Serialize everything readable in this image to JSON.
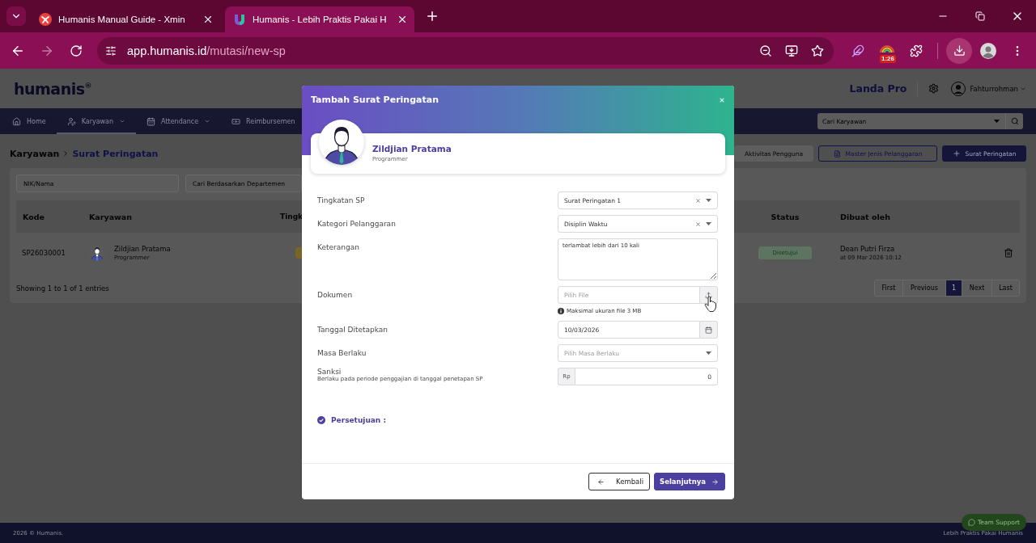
{
  "browser": {
    "tabs": [
      {
        "title": "Humanis Manual Guide - Xmin",
        "selected": false
      },
      {
        "title": "Humanis - Lebih Praktis Pakai H",
        "selected": true
      }
    ],
    "forward_disabled": true,
    "url": {
      "host": "app.humanis.id",
      "path": "/mutasi/new-sp"
    },
    "extension_badge": "1:26"
  },
  "header": {
    "logo": "humanis$^{®}$",
    "company": "Landa Pro",
    "user": "Fahturrohman"
  },
  "nav": {
    "items": [
      {
        "label": "Home",
        "selected": false,
        "dropdown": false
      },
      {
        "label": "Karyawan",
        "selected": true,
        "dropdown": true
      },
      {
        "label": "Attendance",
        "selected": false,
        "dropdown": true
      },
      {
        "label": "Reimbursemen",
        "selected": false,
        "dropdown": false
      }
    ],
    "search": {
      "placeholder": "Cari Karyawan"
    }
  },
  "page": {
    "breadcrumb": [
      "Karyawan",
      "Surat Peringatan"
    ],
    "actions": [
      {
        "kind": "plain",
        "label": "Aktivitas Pengguna"
      },
      {
        "kind": "outline",
        "label": "Master Jenis Pelanggaran"
      },
      {
        "kind": "primary",
        "label": "Surat Peringatan"
      }
    ],
    "filters": [
      {
        "placeholder": "NIK/Nama"
      },
      {
        "placeholder": "Cari Berdasarkan Departemen"
      }
    ],
    "table": {
      "columns": [
        "Kode",
        "Karyawan",
        "Tingk",
        "Status",
        "Dibuat oleh"
      ],
      "rows": [
        {
          "code": "SP26030001",
          "employee": {
            "name": "Zildjian Pratama",
            "role": "Programmer"
          },
          "status": "Disetujui",
          "created_by": "Dean Putri Firza",
          "created_at": "at 09 Mar 2026 10:12"
        }
      ]
    },
    "summary": "Showing 1 to 1 of 1 entries",
    "pagination": [
      {
        "label": "First",
        "selected": false
      },
      {
        "label": "Previous",
        "selected": false
      },
      {
        "label": "1",
        "selected": true
      },
      {
        "label": "Next",
        "selected": false
      },
      {
        "label": "Last",
        "selected": false
      }
    ]
  },
  "dialog": {
    "title": "Tambah Surat Peringatan",
    "employee": {
      "name": "Zildjian Pratama",
      "role": "Programmer"
    },
    "fields": [
      {
        "kind": "select",
        "label": "Tingkatan SP",
        "value": "Surat Peringatan 1",
        "clearable": true
      },
      {
        "kind": "select",
        "label": "Kategori Pelanggaran",
        "value": "Disiplin Waktu",
        "clearable": true
      },
      {
        "kind": "textarea",
        "label": "Keterangan",
        "value": "terlambat lebih dari 10 kali"
      },
      {
        "kind": "file",
        "label": "Dokumen",
        "placeholder": "Pilih File",
        "hint": "Maksimal ukuran file 3 MB"
      },
      {
        "kind": "date",
        "label": "Tanggal Ditetapkan",
        "value": "10/03/2026"
      },
      {
        "kind": "select",
        "label": "Masa Berlaku",
        "placeholder": "Pilih Masa Berlaku",
        "clearable": false
      },
      {
        "kind": "money",
        "label": "Sanksi",
        "sublabel": "Berlaku pada periode penggajian di tanggal penetapan SP",
        "prefix": "Rp",
        "value": "0"
      }
    ],
    "approval": {
      "label": "Persetujuan :"
    },
    "buttons": [
      {
        "kind": "back",
        "label": "Kembali"
      },
      {
        "kind": "next",
        "label": "Selanjutnya"
      }
    ]
  },
  "footer": {
    "copyright": "2026 © Humanis.",
    "tagline": "Lebih Praktis Pakai Humanis",
    "support": "Team Support"
  }
}
